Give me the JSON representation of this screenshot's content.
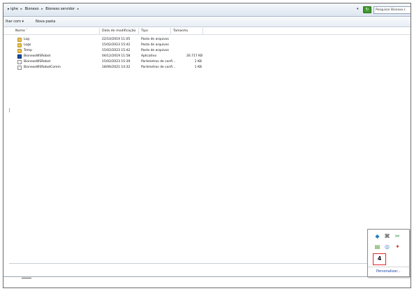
{
  "address_bar": {
    "crumbs": [
      "ighe",
      "Bionexo",
      "Bionexo servidor"
    ],
    "separator": "▸",
    "dropdown_glyph": "▾",
    "search_placeholder": "Pesquisar Bionexo s"
  },
  "command_bar": {
    "share_label": "lhar com",
    "share_arrow": "▾",
    "new_folder_label": "Nova pasta"
  },
  "columns": {
    "name": "Nome",
    "name_sort_glyph": "ˆ",
    "date": "Data de modificação",
    "type": "Tipo",
    "size": "Tamanho"
  },
  "files": [
    {
      "name": "Log",
      "date": "22/10/2019 11:05",
      "type": "Pasta de arquivos",
      "size": "",
      "icon": "folder-icon"
    },
    {
      "name": "Logs",
      "date": "15/02/2023 15:42",
      "type": "Pasta de arquivos",
      "size": "",
      "icon": "folder-icon"
    },
    {
      "name": "Temp",
      "date": "15/02/2023 15:42",
      "type": "Pasta de arquivos",
      "size": "",
      "icon": "folder-icon"
    },
    {
      "name": "BionexoWSRobot",
      "date": "04/12/2019 11:58",
      "type": "Aplicativo",
      "size": "26.717 KB",
      "icon": "application-icon"
    },
    {
      "name": "BionexoWSRobot",
      "date": "15/02/2023 15:39",
      "type": "Parâmetros de confi...",
      "size": "1 KB",
      "icon": "config-file-icon"
    },
    {
      "name": "BionexoWSRobotComm",
      "date": "18/06/2021 14:32",
      "type": "Parâmetros de confi...",
      "size": "1 KB",
      "icon": "config-file-icon"
    }
  ],
  "tray": {
    "icons": [
      {
        "name": "shield-icon",
        "glyph": "◆"
      },
      {
        "name": "bluetooth-icon",
        "glyph": "⌘"
      },
      {
        "name": "snipping-tool-icon",
        "glyph": "✂"
      },
      {
        "name": "network-icon",
        "glyph": "▤"
      },
      {
        "name": "sync-icon",
        "glyph": "◎"
      },
      {
        "name": "alert-icon",
        "glyph": "✦"
      }
    ],
    "count": "4",
    "customize_label": "Personalizar..."
  }
}
